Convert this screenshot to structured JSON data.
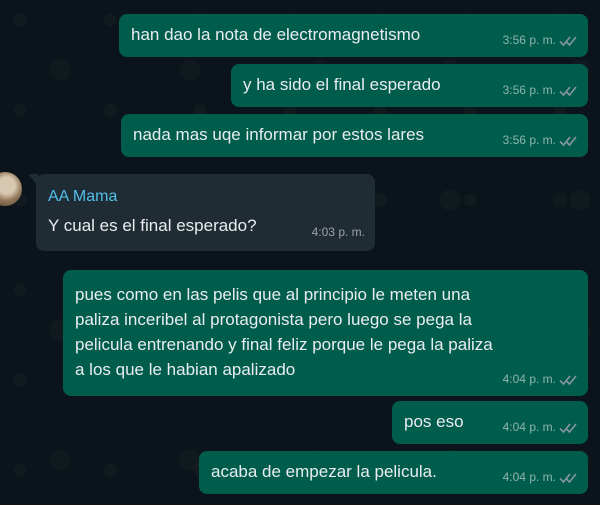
{
  "messages": [
    {
      "id": "m1",
      "direction": "out",
      "text": "han dao la nota de electromagnetismo",
      "time": "3:56 p. m.",
      "status": "read"
    },
    {
      "id": "m2",
      "direction": "out",
      "text": "y ha sido el final esperado",
      "time": "3:56 p. m.",
      "status": "read"
    },
    {
      "id": "m3",
      "direction": "out",
      "text": "nada mas uqe informar por estos lares",
      "time": "3:56 p. m.",
      "status": "read"
    },
    {
      "id": "m4",
      "direction": "in",
      "sender": "AA Mama",
      "text": "Y cual es el final esperado?",
      "time": "4:03 p. m."
    },
    {
      "id": "m5",
      "direction": "out",
      "lines": [
        "pues como en las pelis que al principio le meten una",
        "paliza inceribel al protagonista pero luego se pega la",
        "pelicula entrenando y final feliz porque le pega la paliza",
        "a los que le habian apalizado"
      ],
      "time": "4:04 p. m.",
      "status": "read"
    },
    {
      "id": "m6",
      "direction": "out",
      "text": "pos eso",
      "time": "4:04 p. m.",
      "status": "read"
    },
    {
      "id": "m7",
      "direction": "out",
      "text": "acaba de empezar la pelicula.",
      "time": "4:04 p. m.",
      "status": "read"
    }
  ],
  "colors": {
    "background": "#0b141a",
    "outgoing_bubble": "#005c4b",
    "incoming_bubble": "#202c33",
    "sender_name": "#53bdeb",
    "read_ticks": "#8696a0"
  },
  "icons": {
    "read_receipt": "double-check-icon"
  }
}
